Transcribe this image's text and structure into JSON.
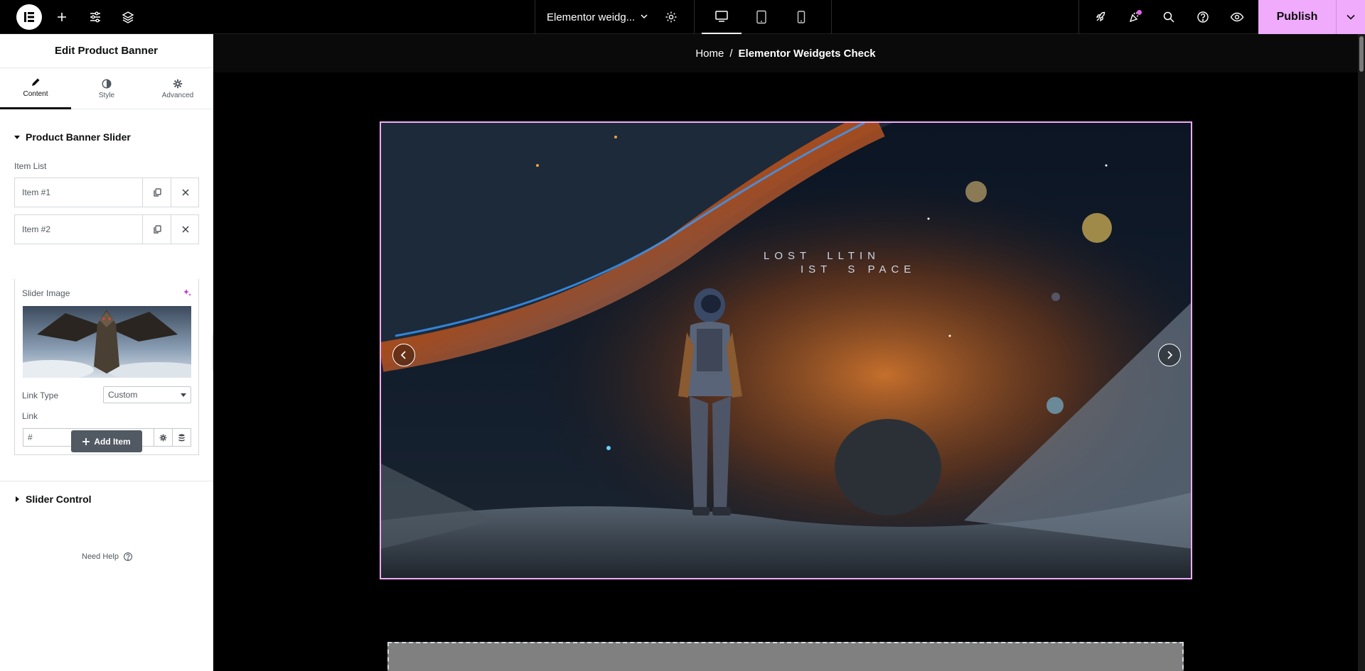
{
  "topbar": {
    "document_title": "Elementor weidg...",
    "publish_label": "Publish",
    "icons": [
      "elementor-logo",
      "add-element-icon",
      "site-settings-icon",
      "structure-icon",
      "chevron-down-icon",
      "page-settings-icon",
      "desktop-icon",
      "tablet-icon",
      "mobile-icon",
      "rocket-icon",
      "whats-new-icon",
      "search-icon",
      "help-icon",
      "preview-eye-icon"
    ]
  },
  "panel": {
    "title": "Edit Product Banner",
    "tabs": [
      {
        "label": "Content",
        "icon": "pencil-icon",
        "active": true
      },
      {
        "label": "Style",
        "icon": "half-circle-icon",
        "active": false
      },
      {
        "label": "Advanced",
        "icon": "gear-icon",
        "active": false
      }
    ],
    "section_title": "Product Banner Slider",
    "item_list_label": "Item List",
    "items": [
      {
        "label": "Item #1"
      },
      {
        "label": "Item #2"
      }
    ],
    "slider_image_label": "Slider Image",
    "link_type_label": "Link Type",
    "link_type_value": "Custom",
    "link_label": "Link",
    "link_value": "#",
    "add_item_label": "Add Item",
    "slider_control_label": "Slider Control",
    "need_help_label": "Need Help"
  },
  "canvas": {
    "breadcrumb": {
      "home": "Home",
      "separator": "/",
      "current": "Elementor Weidgets Check"
    },
    "slide_title_line1": "LOST  LLTIN",
    "slide_title_line2": "IST  S PACE"
  },
  "colors": {
    "accent": "#f0abfc",
    "topbar_bg": "#000000",
    "panel_bg": "#ffffff",
    "add_item_bg": "#515962"
  }
}
